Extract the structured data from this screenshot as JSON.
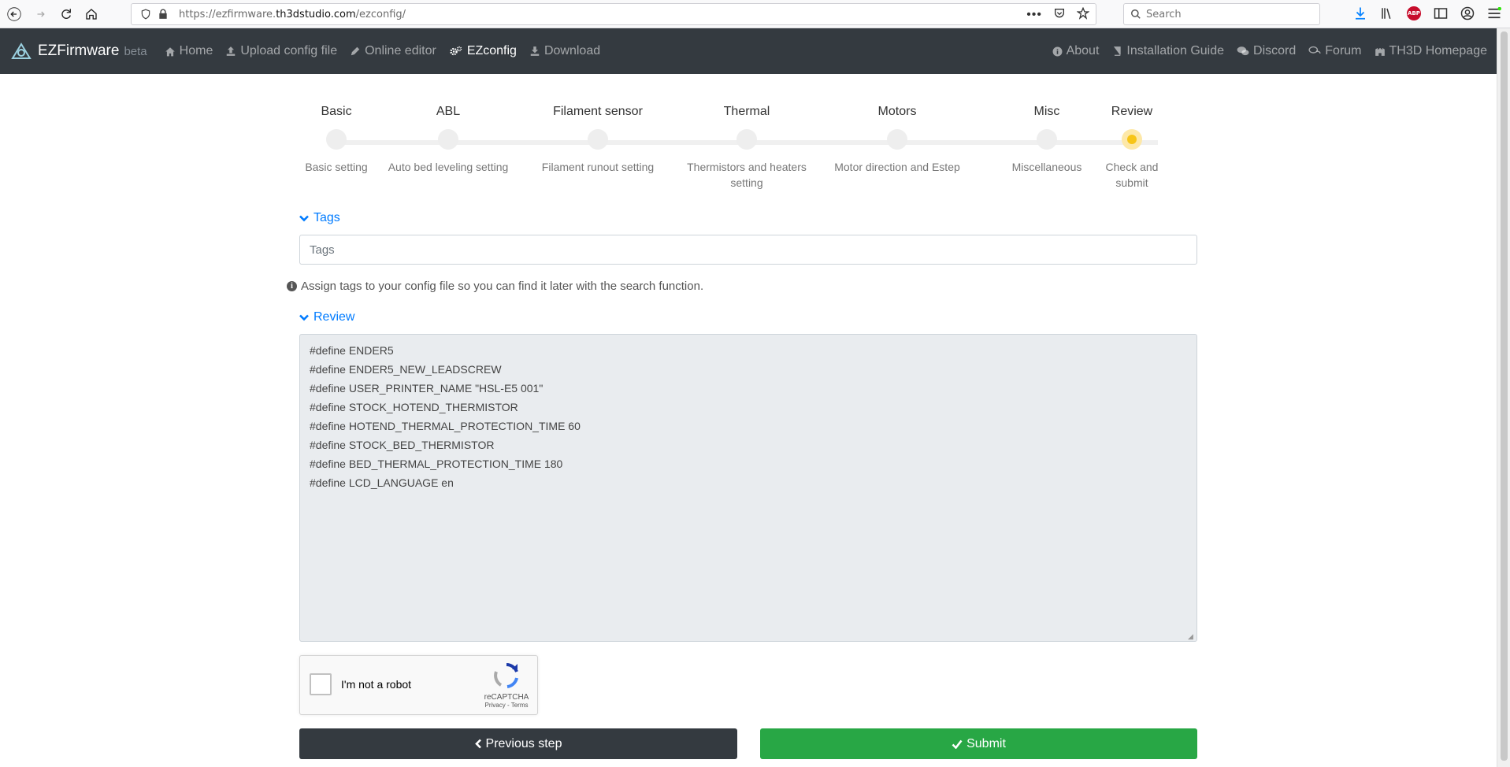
{
  "browser": {
    "url_prefix": "https://ezfirmware.",
    "url_host": "th3dstudio.com",
    "url_path": "/ezconfig/",
    "search_placeholder": "Search",
    "adblock_label": "ABP"
  },
  "navbar": {
    "brand": "EZFirmware",
    "brand_suffix": "beta",
    "left_items": [
      "Home",
      "Upload config file",
      "Online editor",
      "EZconfig",
      "Download"
    ],
    "active_item": "EZconfig",
    "right_items": [
      "About",
      "Installation Guide",
      "Discord",
      "Forum",
      "TH3D Homepage"
    ]
  },
  "stepper": {
    "steps": [
      {
        "title": "Basic",
        "desc": "Basic setting"
      },
      {
        "title": "ABL",
        "desc": "Auto bed leveling setting"
      },
      {
        "title": "Filament sensor",
        "desc": "Filament runout setting"
      },
      {
        "title": "Thermal",
        "desc": "Thermistors and heaters setting"
      },
      {
        "title": "Motors",
        "desc": "Motor direction and Estep"
      },
      {
        "title": "Misc",
        "desc": "Miscellaneous"
      },
      {
        "title": "Review",
        "desc": "Check and submit"
      }
    ],
    "active_step": 7
  },
  "tags": {
    "section_label": "Tags",
    "placeholder": "Tags",
    "help": "Assign tags to your config file so you can find it later with the search function."
  },
  "review": {
    "section_label": "Review",
    "content": "#define ENDER5\n#define ENDER5_NEW_LEADSCREW\n#define USER_PRINTER_NAME \"HSL-E5 001\"\n#define STOCK_HOTEND_THERMISTOR\n#define HOTEND_THERMAL_PROTECTION_TIME 60\n#define STOCK_BED_THERMISTOR\n#define BED_THERMAL_PROTECTION_TIME 180\n#define LCD_LANGUAGE en"
  },
  "recaptcha": {
    "label": "I'm not a robot",
    "brand": "reCAPTCHA",
    "terms": "Privacy - Terms"
  },
  "buttons": {
    "previous": "Previous step",
    "submit": "Submit"
  },
  "colors": {
    "navbar_bg": "#343a40",
    "link": "#007bff",
    "submit_bg": "#28a745",
    "active_step": "#f7c518"
  }
}
